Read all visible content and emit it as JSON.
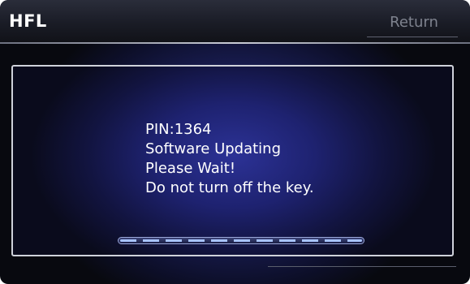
{
  "header": {
    "title": "HFL",
    "return_label": "Return"
  },
  "dialog": {
    "lines": [
      "PIN:1364",
      "Software Updating",
      "Please Wait!",
      "Do not turn off the key."
    ],
    "progress": 1.0
  },
  "colors": {
    "accent": "#a8c4ff",
    "background": "#1b1f5a",
    "text": "#ffffff",
    "disabled_text": "#7e828e"
  }
}
